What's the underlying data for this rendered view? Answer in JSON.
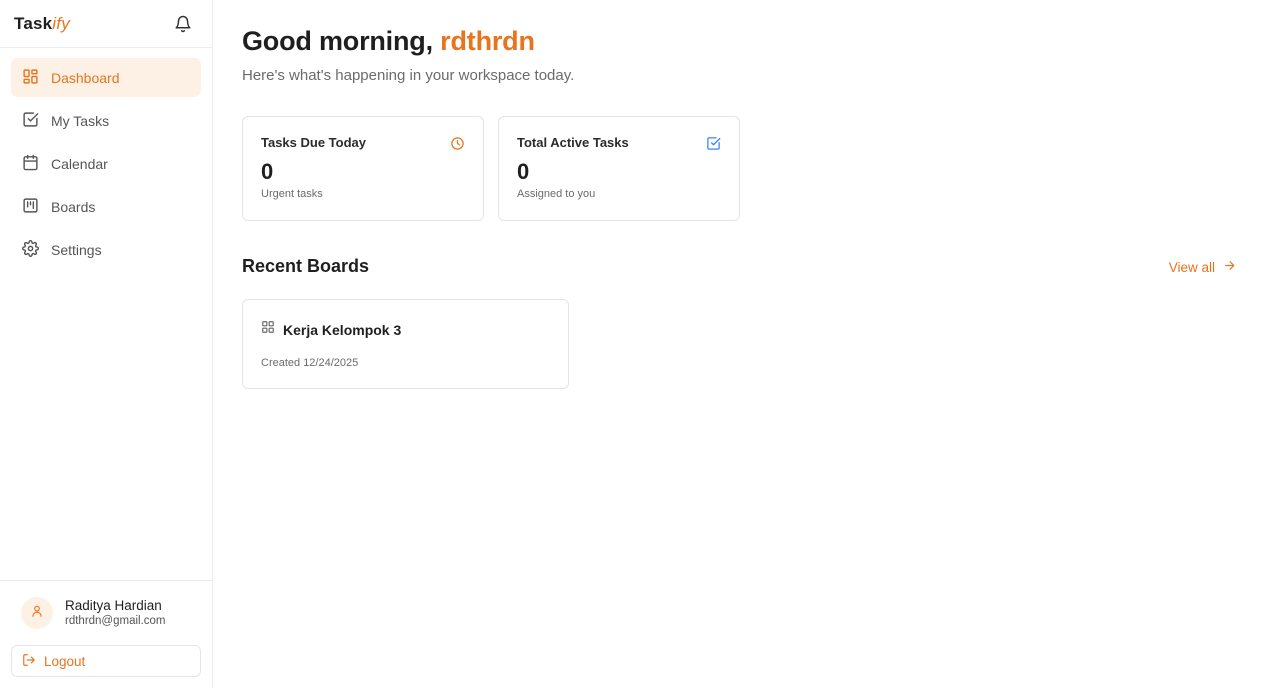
{
  "brand": {
    "logo_main": "Task",
    "logo_accent": "ify"
  },
  "nav": {
    "items": [
      {
        "label": "Dashboard",
        "icon": "grid-icon",
        "active": true
      },
      {
        "label": "My Tasks",
        "icon": "checkbox-icon",
        "active": false
      },
      {
        "label": "Calendar",
        "icon": "calendar-icon",
        "active": false
      },
      {
        "label": "Boards",
        "icon": "kanban-icon",
        "active": false
      },
      {
        "label": "Settings",
        "icon": "gear-icon",
        "active": false
      }
    ]
  },
  "user": {
    "name": "Raditya Hardian",
    "email": "rdthrdn@gmail.com"
  },
  "logout_label": "Logout",
  "greeting": {
    "prefix": "Good morning, ",
    "name": "rdthrdn"
  },
  "subtitle": "Here's what's happening in your workspace today.",
  "stats": [
    {
      "title": "Tasks Due Today",
      "value": "0",
      "caption": "Urgent tasks",
      "icon": "clock-icon"
    },
    {
      "title": "Total Active Tasks",
      "value": "0",
      "caption": "Assigned to you",
      "icon": "check-square-icon"
    }
  ],
  "recent": {
    "title": "Recent Boards",
    "view_all": "View all",
    "boards": [
      {
        "name": "Kerja Kelompok 3",
        "created": "Created 12/24/2025"
      }
    ]
  },
  "colors": {
    "accent": "#e8741e",
    "accent_soft": "#fdf0e5",
    "border": "#e4e4e4"
  }
}
